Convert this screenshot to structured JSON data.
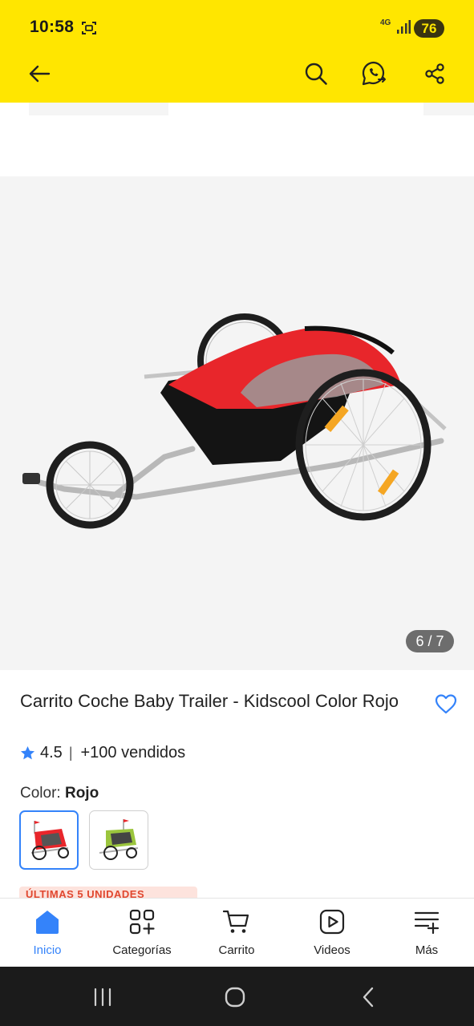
{
  "status_bar": {
    "time": "10:58",
    "network": "4G",
    "battery": "76"
  },
  "header": {
    "back_icon": "arrow-left-icon",
    "search_icon": "search-icon",
    "whatsapp_icon": "whatsapp-share-icon",
    "share_icon": "share-icon"
  },
  "gallery": {
    "counter": "6 / 7"
  },
  "product": {
    "title": "Carrito Coche Baby Trailer - Kidscool Color Rojo",
    "rating": "4.5",
    "separator": "|",
    "sold": "+100 vendidos",
    "color_label": "Color:",
    "color_value": "Rojo",
    "swatches": [
      "Rojo",
      "Verde"
    ],
    "badge": "ÚLTIMAS 5 UNIDADES"
  },
  "bottom_nav": [
    {
      "label": "Inicio",
      "icon": "home-icon",
      "active": true
    },
    {
      "label": "Categorías",
      "icon": "categories-icon",
      "active": false
    },
    {
      "label": "Carrito",
      "icon": "cart-icon",
      "active": false
    },
    {
      "label": "Videos",
      "icon": "video-icon",
      "active": false
    },
    {
      "label": "Más",
      "icon": "more-icon",
      "active": false
    }
  ],
  "colors": {
    "brand_yellow": "#ffe600",
    "accent_blue": "#3483fa",
    "badge_red": "#e0472f"
  }
}
